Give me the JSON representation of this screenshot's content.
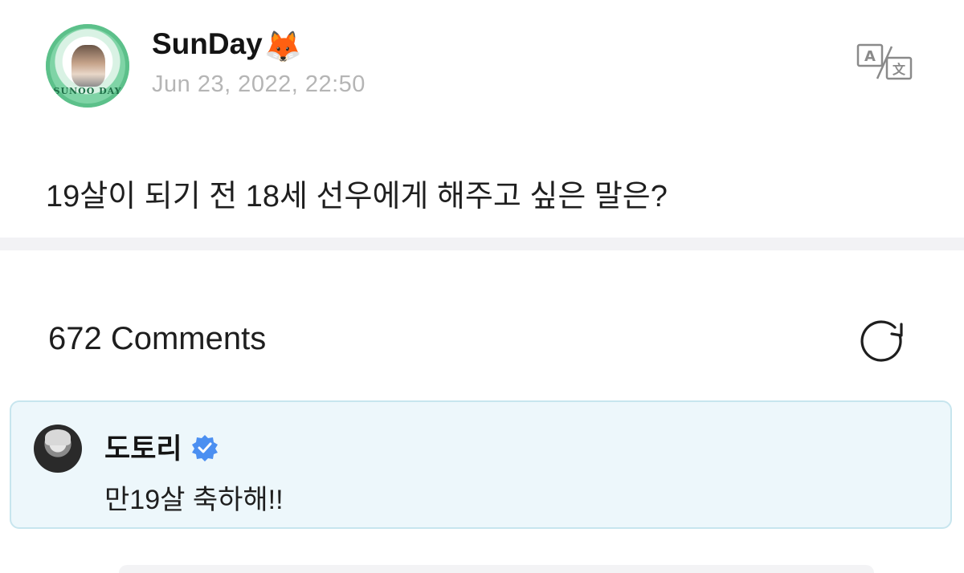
{
  "post": {
    "author_name": "SunDay",
    "author_emoji": "🦊",
    "avatar_ring_text": "SUNOO DAY",
    "timestamp": "Jun 23, 2022, 22:50",
    "text": "19살이 되기 전 18세 선우에게 해주고 싶은 말은?",
    "translate_icon": "translate-icon"
  },
  "comments": {
    "count_label": "672 Comments",
    "refresh_icon": "refresh-icon",
    "items": [
      {
        "author": "도토리",
        "verified": true,
        "verified_icon": "verified-badge-icon",
        "text": "만19살 축하해!!"
      }
    ]
  },
  "colors": {
    "comment_highlight_bg": "#edf7fb",
    "comment_highlight_border": "#c7e5ee",
    "verified_blue": "#4b8ff1",
    "timestamp_gray": "#b5b5b5",
    "divider": "#f2f2f5"
  }
}
